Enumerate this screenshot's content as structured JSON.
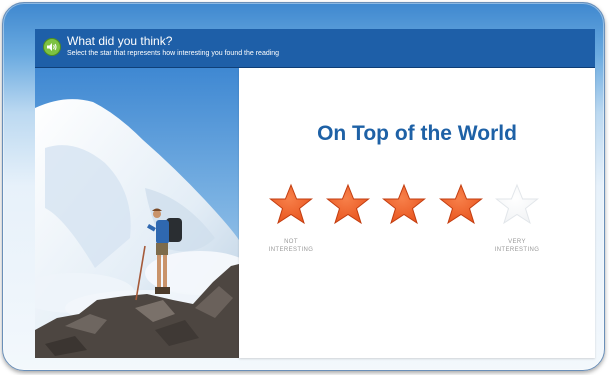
{
  "header": {
    "title": "What did you think?",
    "subtitle": "Select the star that represents how interesting you found the reading"
  },
  "panel": {
    "title": "On Top of the World",
    "rating": {
      "selected": 4,
      "max": 5,
      "low_label": "NOT INTERESTING",
      "high_label": "VERY INTERESTING"
    }
  },
  "colors": {
    "header_bg": "#1e5fa8",
    "title": "#1e61a6",
    "star_filled": "#e8541e",
    "star_empty": "#f1f3f5"
  },
  "icons": {
    "audio": "speaker-icon",
    "star": "star-icon"
  }
}
